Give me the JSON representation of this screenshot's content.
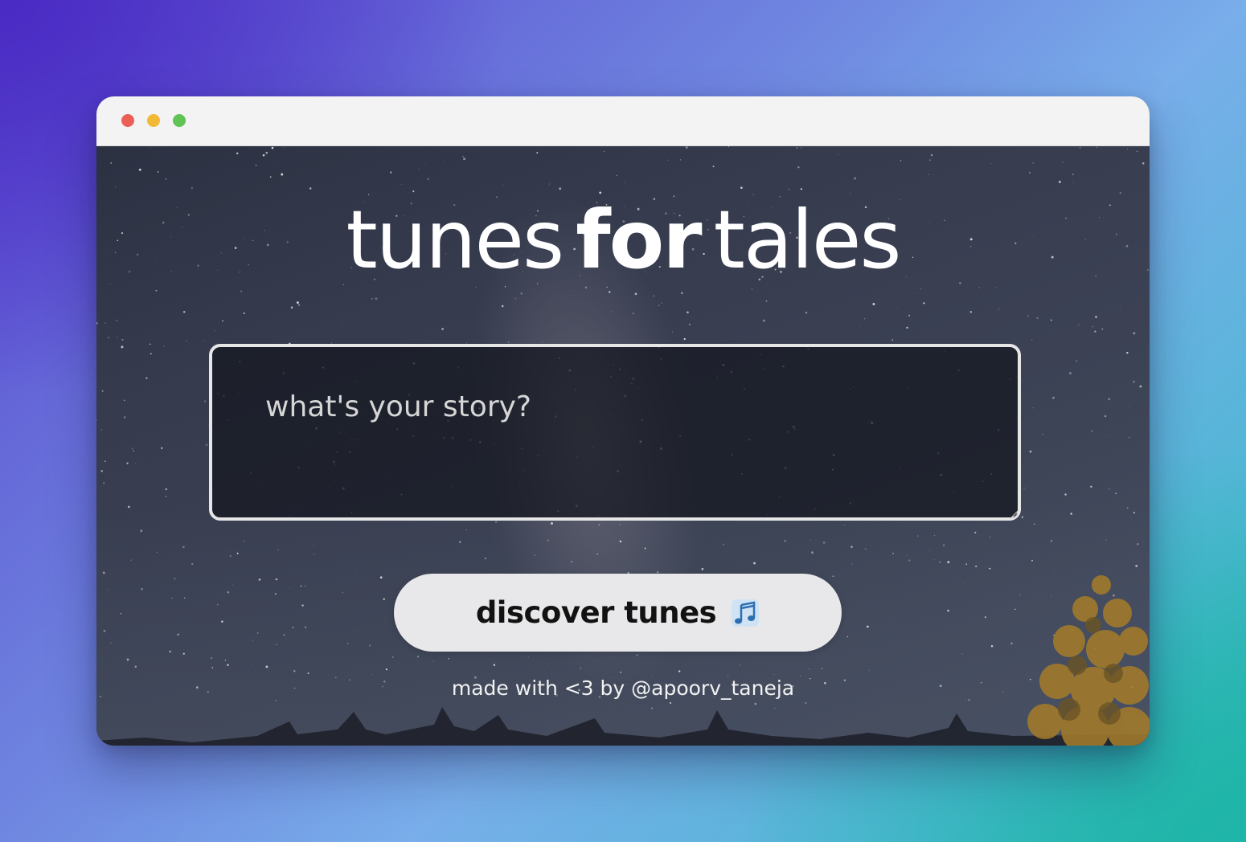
{
  "window": {
    "controls": [
      "close",
      "minimize",
      "maximize"
    ]
  },
  "brand": {
    "word1": "tunes",
    "word2": "for",
    "word3": "tales"
  },
  "story": {
    "placeholder": "what's your story?",
    "value": ""
  },
  "discover": {
    "label": "discover tunes",
    "icon": "music-notes-icon"
  },
  "footer": {
    "credit": "made with <3 by @apoorv_taneja"
  },
  "colors": {
    "button_bg": "#e8e8ea",
    "textarea_border": "#e6e6e6",
    "close": "#ec5f56",
    "minimize": "#f2b937",
    "maximize": "#5fc454"
  }
}
